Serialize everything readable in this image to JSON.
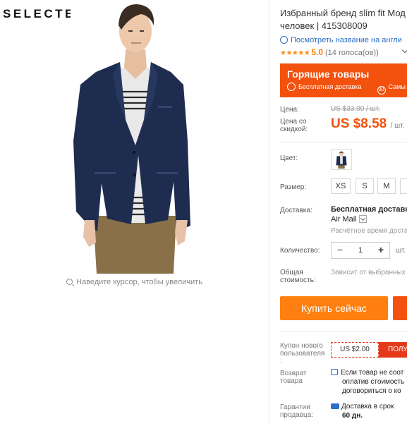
{
  "brand_logo": "SELECTED",
  "zoom_hint": "Наведите курсор, чтобы увеличить",
  "product": {
    "title_line1": "Избранный бренд slim fit Мод",
    "title_line2": "человек | 415308009",
    "translate_link": "Посмотреть название на англи",
    "rating_stars": "★★★★★",
    "rating_score": "5.0",
    "rating_votes": "(14 голоса(ов))"
  },
  "promo": {
    "title": "Горящие товары",
    "free_shipping": "Бесплатная доставка",
    "return_badge": "30",
    "return_text": "Самы"
  },
  "price": {
    "label": "Цена:",
    "old": "US $33.00 / шт.",
    "discount_label_1": "Цена со",
    "discount_label_2": "скидкой:",
    "current": "US $8.58",
    "unit": "/ шт."
  },
  "color": {
    "label": "Цвет:"
  },
  "size": {
    "label": "Размер:",
    "options": [
      "XS",
      "S",
      "M",
      ""
    ]
  },
  "shipping": {
    "label": "Доставка:",
    "method": "Бесплатная доставка",
    "carrier": "Air Mail",
    "time_note": "Расчётное время доставки"
  },
  "quantity": {
    "label": "Количество:",
    "minus": "−",
    "value": "1",
    "plus": "+",
    "unit": "шт."
  },
  "total": {
    "label_1": "Общая",
    "label_2": "стоимость:",
    "note": "Зависит от выбранных характеристик"
  },
  "buttons": {
    "buy_now": "Купить сейчас"
  },
  "coupon": {
    "label_1": "Купон нового",
    "label_2": "пользователя",
    "label_3": ":",
    "amount": "US $2.00",
    "get": "ПОЛУ"
  },
  "returns": {
    "label_1": "Возврат",
    "label_2": "товара",
    "line1": "Если товар не соот",
    "line2": "оплатив стоимость",
    "line3": "договориться о ко"
  },
  "guarantee": {
    "label_1": "Гарантии",
    "label_2": "продавца:",
    "line1": "Доставка в срок",
    "line2": "60 дн."
  }
}
